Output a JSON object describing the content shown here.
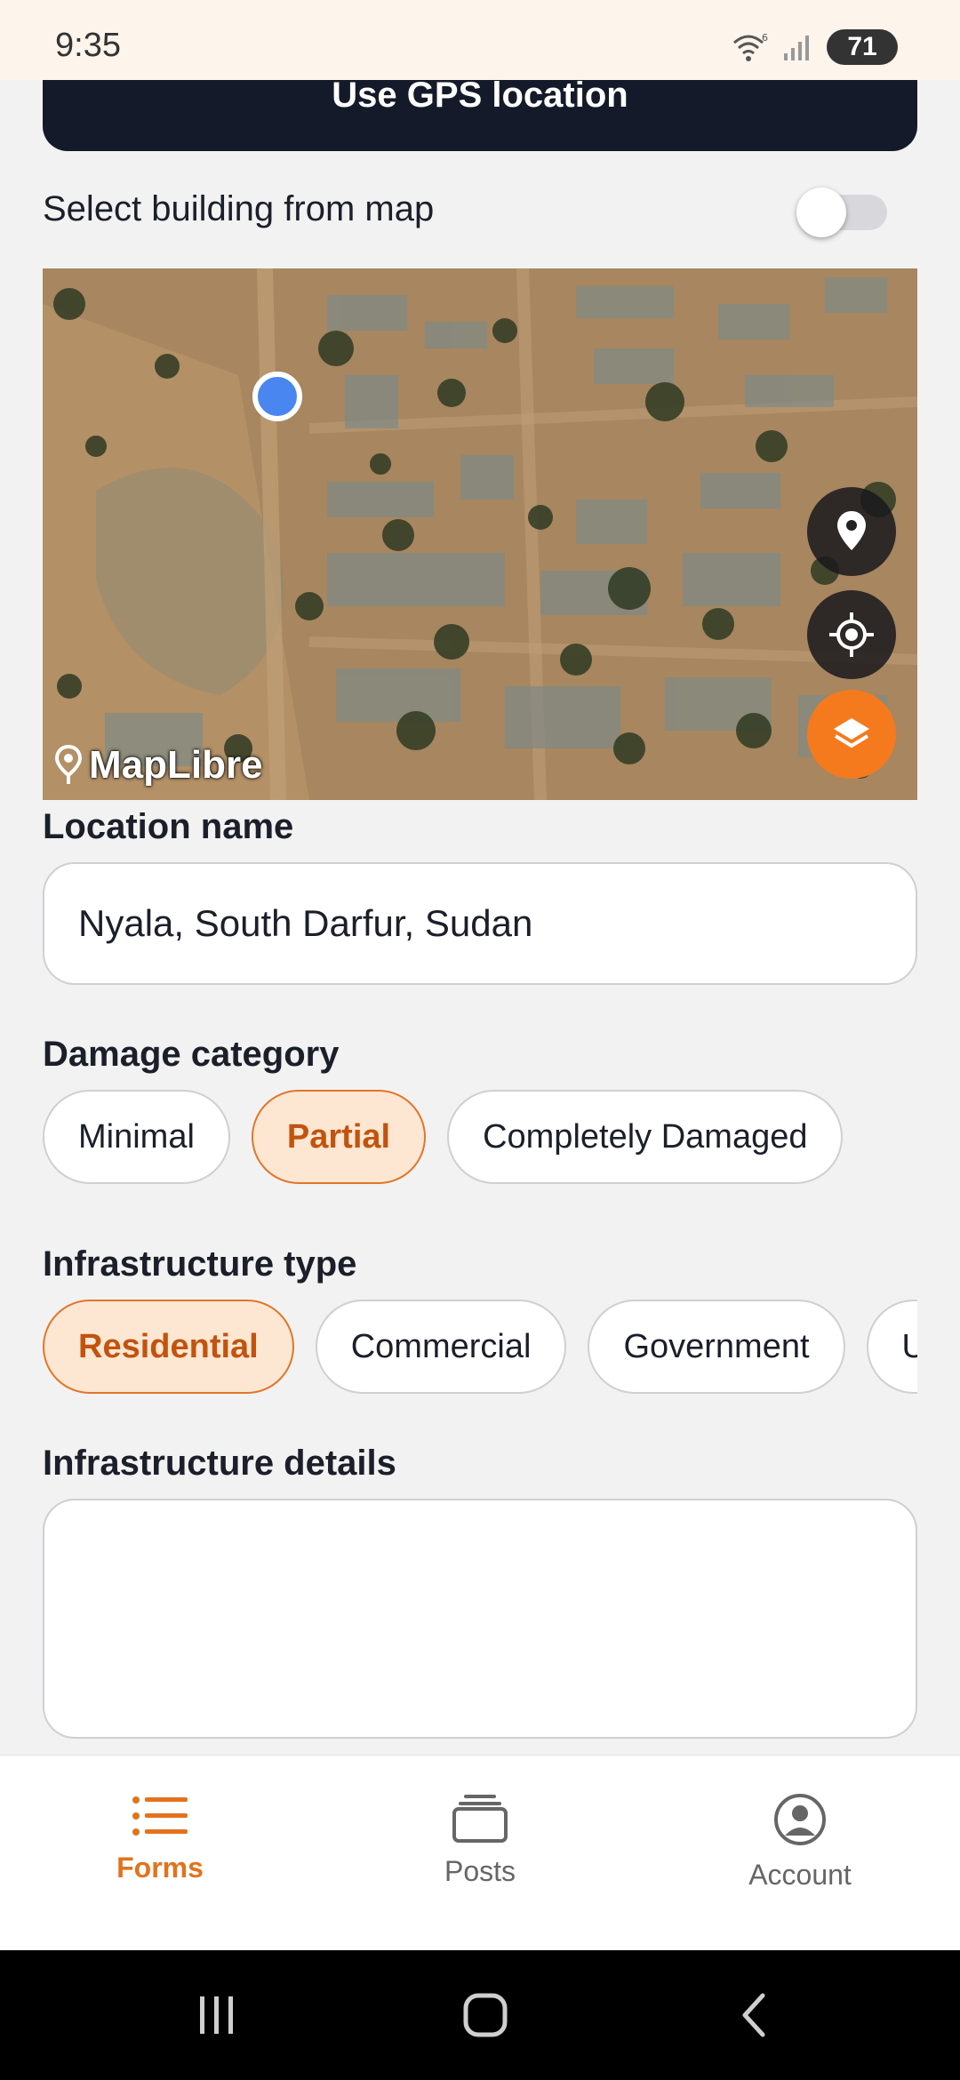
{
  "status_bar": {
    "time": "9:35",
    "battery": "71"
  },
  "gps_button_label": "Use GPS location",
  "select_building": {
    "label": "Select building from map",
    "enabled": false
  },
  "map": {
    "attribution": "MapLibre"
  },
  "location_name": {
    "label": "Location name",
    "value": "Nyala, South Darfur, Sudan"
  },
  "damage_category": {
    "label": "Damage category",
    "options": [
      "Minimal",
      "Partial",
      "Completely Damaged"
    ],
    "selected": "Partial"
  },
  "infrastructure_type": {
    "label": "Infrastructure type",
    "options": [
      "Residential",
      "Commercial",
      "Government",
      "U"
    ],
    "selected": "Residential"
  },
  "infrastructure_details": {
    "label": "Infrastructure details",
    "value": ""
  },
  "bottom_nav": {
    "items": [
      {
        "label": "Forms",
        "icon": "list-icon",
        "active": true
      },
      {
        "label": "Posts",
        "icon": "stack-icon",
        "active": false
      },
      {
        "label": "Account",
        "icon": "account-icon",
        "active": false
      }
    ]
  },
  "colors": {
    "accent": "#f57a1e",
    "dark_button": "#141a29",
    "chip_selected_bg": "#fde7d2"
  }
}
